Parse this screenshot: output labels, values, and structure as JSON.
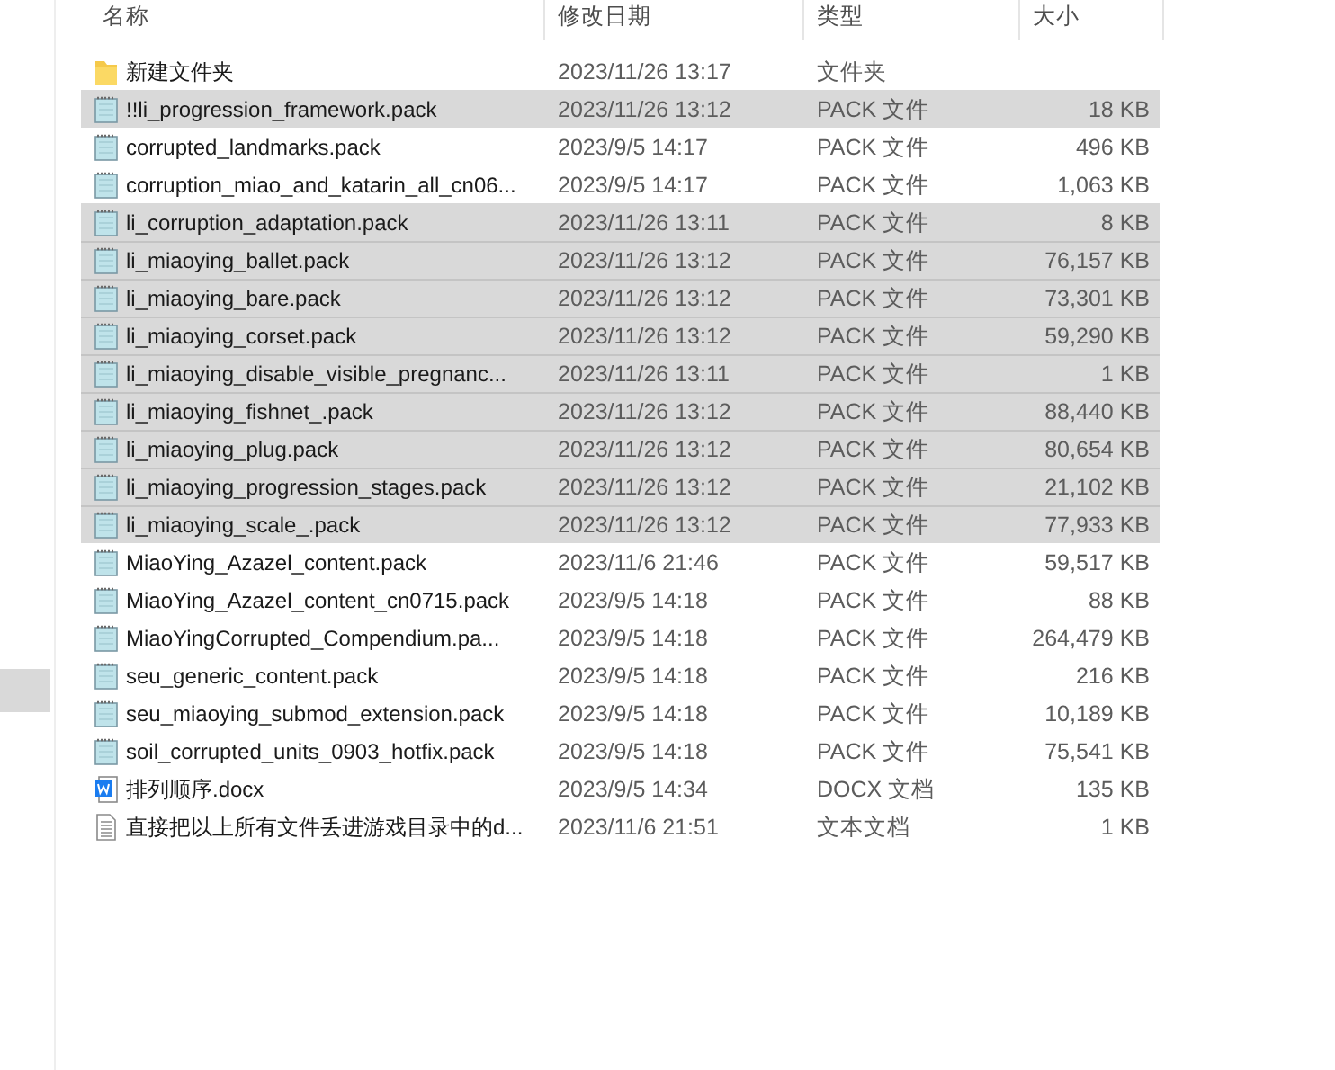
{
  "table": {
    "columns": [
      {
        "label": "名称"
      },
      {
        "label": "修改日期"
      },
      {
        "label": "类型"
      },
      {
        "label": "大小"
      }
    ],
    "rows": [
      {
        "kind": "folder",
        "name": "新建文件夹",
        "date": "2023/11/26 13:17",
        "type": "文件夹",
        "selected": false
      },
      {
        "kind": "pack",
        "name": "!!li_progression_framework.pack",
        "date": "2023/11/26 13:12",
        "type": "PACK 文件",
        "size": "18 KB",
        "selected": true
      },
      {
        "kind": "pack",
        "name": "corrupted_landmarks.pack",
        "date": "2023/9/5 14:17",
        "type": "PACK 文件",
        "size": "496 KB",
        "selected": false
      },
      {
        "kind": "pack",
        "name": "corruption_miao_and_katarin_all_cn06...",
        "date": "2023/9/5 14:17",
        "type": "PACK 文件",
        "size": "1,063 KB",
        "selected": false
      },
      {
        "kind": "pack",
        "name": "li_corruption_adaptation.pack",
        "date": "2023/11/26 13:11",
        "type": "PACK 文件",
        "size": "8 KB",
        "selected": true
      },
      {
        "kind": "pack",
        "name": "li_miaoying_ballet.pack",
        "date": "2023/11/26 13:12",
        "type": "PACK 文件",
        "size": "76,157 KB",
        "selected": true
      },
      {
        "kind": "pack",
        "name": "li_miaoying_bare.pack",
        "date": "2023/11/26 13:12",
        "type": "PACK 文件",
        "size": "73,301 KB",
        "selected": true
      },
      {
        "kind": "pack",
        "name": "li_miaoying_corset.pack",
        "date": "2023/11/26 13:12",
        "type": "PACK 文件",
        "size": "59,290 KB",
        "selected": true
      },
      {
        "kind": "pack",
        "name": "li_miaoying_disable_visible_pregnanc...",
        "date": "2023/11/26 13:11",
        "type": "PACK 文件",
        "size": "1 KB",
        "selected": true
      },
      {
        "kind": "pack",
        "name": "li_miaoying_fishnet_.pack",
        "date": "2023/11/26 13:12",
        "type": "PACK 文件",
        "size": "88,440 KB",
        "selected": true
      },
      {
        "kind": "pack",
        "name": "li_miaoying_plug.pack",
        "date": "2023/11/26 13:12",
        "type": "PACK 文件",
        "size": "80,654 KB",
        "selected": true
      },
      {
        "kind": "pack",
        "name": "li_miaoying_progression_stages.pack",
        "date": "2023/11/26 13:12",
        "type": "PACK 文件",
        "size": "21,102 KB",
        "selected": true
      },
      {
        "kind": "pack",
        "name": "li_miaoying_scale_.pack",
        "date": "2023/11/26 13:12",
        "type": "PACK 文件",
        "size": "77,933 KB",
        "selected": true
      },
      {
        "kind": "pack",
        "name": "MiaoYing_Azazel_content.pack",
        "date": "2023/11/6 21:46",
        "type": "PACK 文件",
        "size": "59,517 KB",
        "selected": false
      },
      {
        "kind": "pack",
        "name": "MiaoYing_Azazel_content_cn0715.pack",
        "date": "2023/9/5 14:18",
        "type": "PACK 文件",
        "size": "88 KB",
        "selected": false
      },
      {
        "kind": "pack",
        "name": "MiaoYingCorrupted_Compendium.pa...",
        "date": "2023/9/5 14:18",
        "type": "PACK 文件",
        "size": "264,479 KB",
        "selected": false
      },
      {
        "kind": "pack",
        "name": "seu_generic_content.pack",
        "date": "2023/9/5 14:18",
        "type": "PACK 文件",
        "size": "216 KB",
        "selected": false
      },
      {
        "kind": "pack",
        "name": "seu_miaoying_submod_extension.pack",
        "date": "2023/9/5 14:18",
        "type": "PACK 文件",
        "size": "10,189 KB",
        "selected": false
      },
      {
        "kind": "pack",
        "name": "soil_corrupted_units_0903_hotfix.pack",
        "date": "2023/9/5 14:18",
        "type": "PACK 文件",
        "size": "75,541 KB",
        "selected": false
      },
      {
        "kind": "docx",
        "name": "排列顺序.docx",
        "date": "2023/9/5 14:34",
        "type": "DOCX 文档",
        "size": "135 KB",
        "selected": false
      },
      {
        "kind": "text",
        "name": "直接把以上所有文件丢进游戏目录中的d...",
        "date": "2023/11/6 21:51",
        "type": "文本文档",
        "size": "1 KB",
        "selected": false
      }
    ]
  }
}
